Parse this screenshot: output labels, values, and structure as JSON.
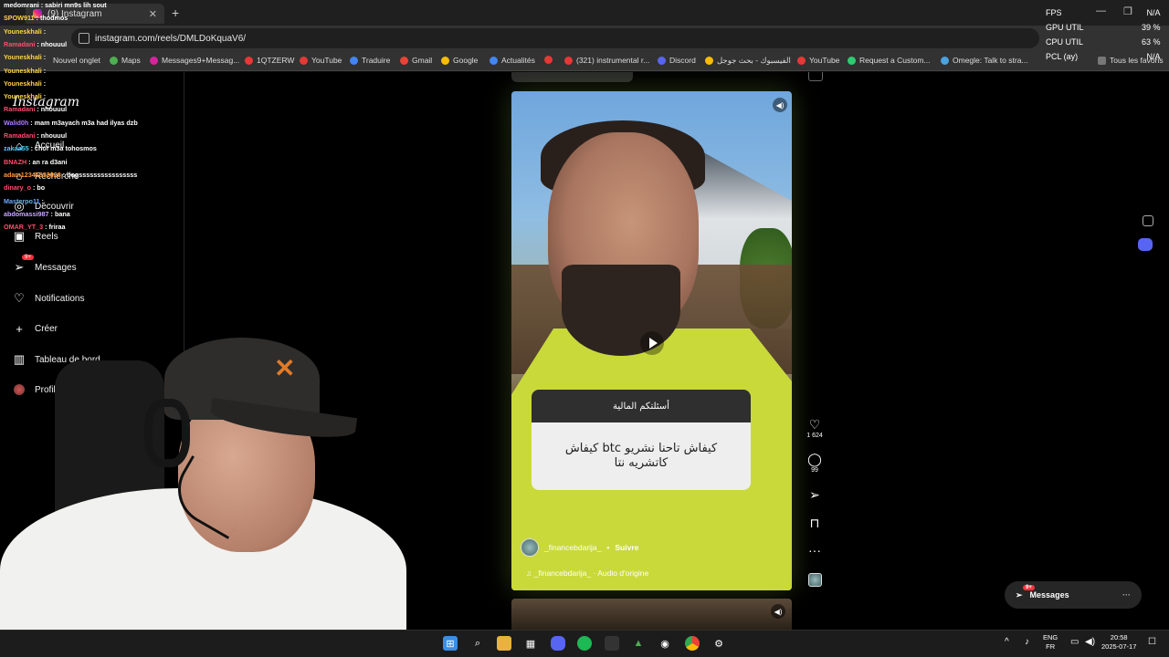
{
  "browser": {
    "tab_title": "(9) Instagram",
    "url": "instagram.com/reels/DMLDoKquaV6/",
    "bookmarks": [
      "Nouvel onglet",
      "Maps",
      "Messages9+Messag...",
      "1QTZERW",
      "YouTube",
      "Traduire",
      "Gmail",
      "Google",
      "Actualités",
      "(321) instrumental r...",
      "Discord",
      "الفيسبوك - بحث جوجل",
      "YouTube",
      "Request a Custom...",
      "Omegle: Talk to stra...",
      "Tous les favoris"
    ]
  },
  "sidebar": {
    "logo": "Instagram",
    "items": [
      {
        "label": "Accueil",
        "icon": "home-icon"
      },
      {
        "label": "Recherche",
        "icon": "search-icon"
      },
      {
        "label": "Découvrir",
        "icon": "compass-icon"
      },
      {
        "label": "Reels",
        "icon": "reels-icon"
      },
      {
        "label": "Messages",
        "icon": "send-icon",
        "badge": "9+"
      },
      {
        "label": "Notifications",
        "icon": "heart-icon"
      },
      {
        "label": "Créer",
        "icon": "plus-icon"
      },
      {
        "label": "Tableau de bord",
        "icon": "chart-icon"
      },
      {
        "label": "Profil",
        "icon": "avatar-icon"
      }
    ]
  },
  "chat": [
    {
      "user": "medomrani",
      "text": "sabiri mn9s lih sout",
      "color": "#ffffff"
    },
    {
      "user": "SPOW911",
      "text": "thodmos",
      "color": "#ffd24a"
    },
    {
      "user": "Youneskhali",
      "text": "",
      "color": "#ffd24a"
    },
    {
      "user": "Ramadani",
      "text": "nhouuul",
      "color": "#ff4d6d"
    },
    {
      "user": "Youneskhali",
      "text": "",
      "color": "#ffd24a"
    },
    {
      "user": "Youneskhali",
      "text": "",
      "color": "#ffd24a"
    },
    {
      "user": "Youneskhali",
      "text": "",
      "color": "#ffd24a"
    },
    {
      "user": "Youneskhali",
      "text": "",
      "color": "#ffd24a"
    },
    {
      "user": "Ramadani",
      "text": "nhouuul",
      "color": "#ff4d6d"
    },
    {
      "user": "Walid0h",
      "text": "mam m3ayach m3a had ilyas dzb",
      "color": "#b07cff"
    },
    {
      "user": "Ramadani",
      "text": "nhouuul",
      "color": "#ff4d6d"
    },
    {
      "user": "zakaa55",
      "text": "chof m3a tohosmos",
      "color": "#4ad0ff"
    },
    {
      "user": "BNAZH",
      "text": "an ra d3ani",
      "color": "#ff4d6d"
    },
    {
      "user": "adam12345833828",
      "text": "bogssssssssssssssss",
      "color": "#ff9a3c"
    },
    {
      "user": "dinary_o",
      "text": "bo",
      "color": "#ff4d6d"
    },
    {
      "user": "Masterpo11",
      "text": "",
      "color": "#6aa8ff"
    },
    {
      "user": "abdomassi987",
      "text": "bana",
      "color": "#c9a7ff"
    },
    {
      "user": "OMAR_YT_3",
      "text": "friraa",
      "color": "#ff4d6d"
    }
  ],
  "reel": {
    "question_header": "أسئلتكم المالية",
    "question_body": "كيفاش تاحنا نشريو btc كيفاش كاتشريه نتا",
    "author": "_financebdarija_",
    "follow": "Suivre",
    "audio": "_financebdarija_ · Audio d'origine",
    "likes": "1 624",
    "comments": "99"
  },
  "messages_button": {
    "label": "Messages",
    "badge": "9+"
  },
  "stats": {
    "labels": [
      "FPS",
      "GPU UTIL",
      "CPU UTIL",
      "PCL (ay)"
    ],
    "values": [
      "N/A",
      "39 %",
      "63 %",
      "N/A"
    ]
  },
  "taskbar": {
    "lang": [
      "ENG",
      "FR"
    ],
    "time": "20:58",
    "date": "2025-07-17"
  },
  "colors": {
    "badge": "#ff3040",
    "shirt": "#c9d93a",
    "cap_logo": "#e07b2a"
  }
}
